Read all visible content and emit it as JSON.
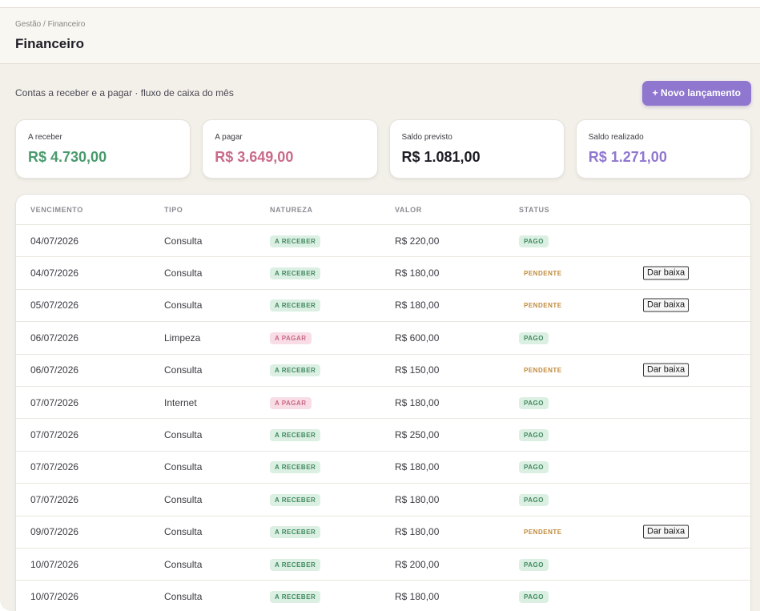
{
  "header": {
    "breadcrumb": "Gestão / Financeiro",
    "title": "Financeiro"
  },
  "subheader": {
    "subtitle": "Contas a receber e a pagar · fluxo de caixa do mês",
    "new_button_label": "+ Novo lançamento"
  },
  "summary": [
    {
      "label": "A receber",
      "value": "R$ 4.730,00",
      "color": "#4a9a6e"
    },
    {
      "label": "A pagar",
      "value": "R$ 3.649,00",
      "color": "#c96a8a"
    },
    {
      "label": "Saldo previsto",
      "value": "R$ 1.081,00",
      "color": "#1e1e26"
    },
    {
      "label": "Saldo realizado",
      "value": "R$ 1.271,00",
      "color": "#8f77cf"
    }
  ],
  "table": {
    "headers": [
      "VENCIMENTO",
      "TIPO",
      "NATUREZA",
      "VALOR",
      "STATUS"
    ],
    "action_label": "Dar baixa",
    "rows": [
      {
        "date": "04/07/2026",
        "tipo": "Consulta",
        "natureza": "A RECEBER",
        "valor": "R$ 220,00",
        "status": "PAGO"
      },
      {
        "date": "04/07/2026",
        "tipo": "Consulta",
        "natureza": "A RECEBER",
        "valor": "R$ 180,00",
        "status": "PENDENTE"
      },
      {
        "date": "05/07/2026",
        "tipo": "Consulta",
        "natureza": "A RECEBER",
        "valor": "R$ 180,00",
        "status": "PENDENTE"
      },
      {
        "date": "06/07/2026",
        "tipo": "Limpeza",
        "natureza": "A PAGAR",
        "valor": "R$ 600,00",
        "status": "PAGO"
      },
      {
        "date": "06/07/2026",
        "tipo": "Consulta",
        "natureza": "A RECEBER",
        "valor": "R$ 150,00",
        "status": "PENDENTE"
      },
      {
        "date": "07/07/2026",
        "tipo": "Internet",
        "natureza": "A PAGAR",
        "valor": "R$ 180,00",
        "status": "PAGO"
      },
      {
        "date": "07/07/2026",
        "tipo": "Consulta",
        "natureza": "A RECEBER",
        "valor": "R$ 250,00",
        "status": "PAGO"
      },
      {
        "date": "07/07/2026",
        "tipo": "Consulta",
        "natureza": "A RECEBER",
        "valor": "R$ 180,00",
        "status": "PAGO"
      },
      {
        "date": "07/07/2026",
        "tipo": "Consulta",
        "natureza": "A RECEBER",
        "valor": "R$ 180,00",
        "status": "PAGO"
      },
      {
        "date": "09/07/2026",
        "tipo": "Consulta",
        "natureza": "A RECEBER",
        "valor": "R$ 180,00",
        "status": "PENDENTE"
      },
      {
        "date": "10/07/2026",
        "tipo": "Consulta",
        "natureza": "A RECEBER",
        "valor": "R$ 200,00",
        "status": "PAGO"
      },
      {
        "date": "10/07/2026",
        "tipo": "Consulta",
        "natureza": "A RECEBER",
        "valor": "R$ 180,00",
        "status": "PAGO"
      }
    ]
  }
}
